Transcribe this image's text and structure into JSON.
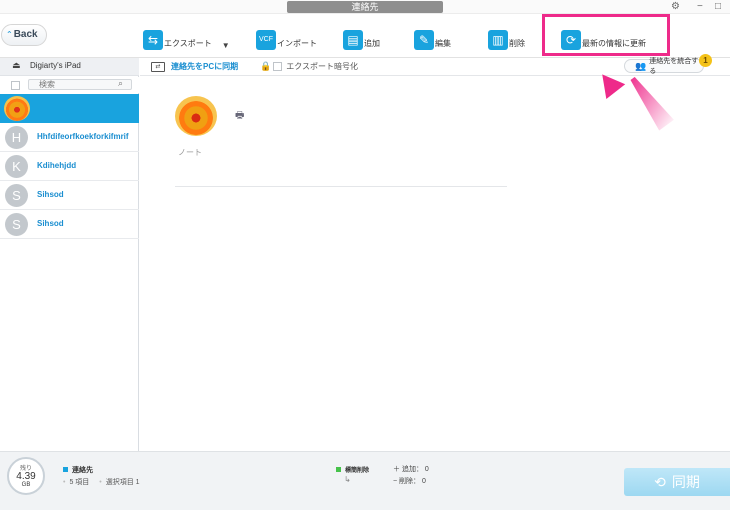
{
  "window": {
    "title": "連絡先",
    "controls": {
      "settings": "⚙",
      "minimize": "−",
      "maximize": "□"
    }
  },
  "toolbar": {
    "back_label": "Back",
    "tools": {
      "export": "エクスポート",
      "import": "インポート",
      "add": "追加",
      "edit": "編集",
      "delete": "削除",
      "refresh": "最新の情報に更新"
    },
    "icons": {
      "export": "export-icon",
      "import": "vcf-import-icon",
      "add": "add-contact-icon",
      "edit": "edit-icon",
      "delete": "trash-icon",
      "refresh": "refresh-icon"
    },
    "highlight_color": "#ee2a8a"
  },
  "sidebar": {
    "device_name": "Digiarty's iPad",
    "search_placeholder": "検索",
    "contacts": [
      {
        "initial": "",
        "name": "",
        "selected": true,
        "photo": true
      },
      {
        "initial": "H",
        "name": "Hhfdifeorfkoekforkifmrif"
      },
      {
        "initial": "K",
        "name": "Kdihehjdd"
      },
      {
        "initial": "S",
        "name": "Sihsod"
      },
      {
        "initial": "S",
        "name": "Sihsod"
      }
    ]
  },
  "main": {
    "sync_to_pc": "連絡先をPCに同期",
    "export_encrypt": "エクスポート暗号化",
    "merge_contacts": "連絡先を統合する",
    "merge_badge": "1",
    "note_label": "ノート"
  },
  "footer": {
    "storage_label": "残り",
    "storage_value": "4.39",
    "storage_unit": "GB",
    "legend_label": "連絡先",
    "items_text": "5 項目",
    "selected_text": "選択項目 1",
    "pending_label": "標簡削除",
    "add_text": "＋ 追加： 0",
    "delete_text": "− 削除： 0",
    "sync_button": "同期"
  },
  "colors": {
    "accent": "#19a3de",
    "highlight": "#ee2a8a",
    "badge": "#f4c218",
    "sync_button": "#9dd8f1"
  }
}
